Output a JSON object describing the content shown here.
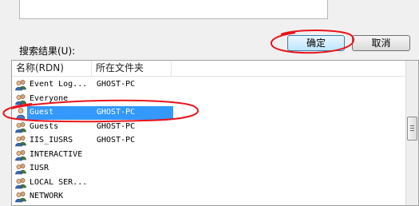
{
  "search_results_label": "搜索结果(U):",
  "buttons": {
    "ok_label": "确定",
    "cancel_label": "取消"
  },
  "columns": {
    "name": "名称(RDN)",
    "folder": "所在文件夹"
  },
  "rows": [
    {
      "name": "Event Log...",
      "folder": "GHOST-PC",
      "icon": "group-icon"
    },
    {
      "name": "Everyone",
      "folder": "",
      "icon": "group-icon"
    },
    {
      "name": "Guest",
      "folder": "GHOST-PC",
      "icon": "user-icon",
      "selected": true
    },
    {
      "name": "Guests",
      "folder": "GHOST-PC",
      "icon": "group-icon"
    },
    {
      "name": "IIS_IUSRS",
      "folder": "GHOST-PC",
      "icon": "group-icon"
    },
    {
      "name": "INTERACTIVE",
      "folder": "",
      "icon": "group-icon"
    },
    {
      "name": "IUSR",
      "folder": "",
      "icon": "group-icon"
    },
    {
      "name": "LOCAL SER...",
      "folder": "",
      "icon": "group-icon"
    },
    {
      "name": "NETWORK",
      "folder": "",
      "icon": "group-icon"
    }
  ],
  "colors": {
    "selection": "#3399ff",
    "annotation": "#e8141b"
  }
}
